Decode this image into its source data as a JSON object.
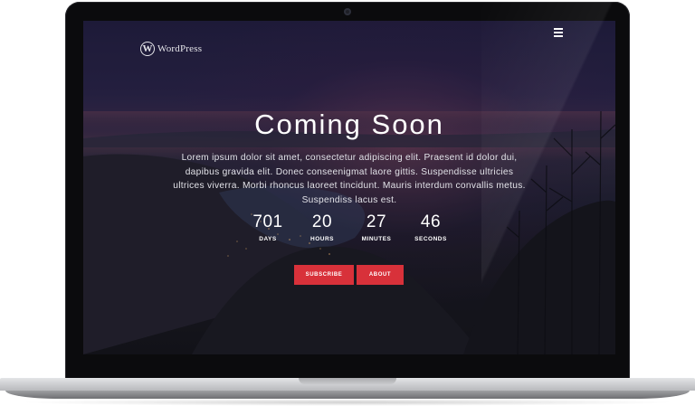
{
  "header": {
    "logo_text": "WordPress",
    "logo_mark": "W",
    "menu_icon": "hamburger-menu-icon"
  },
  "hero": {
    "title": "Coming Soon",
    "description": "Lorem ipsum dolor sit amet, consectetur adipiscing elit. Praesent id dolor dui, dapibus gravida elit. Donec conseenigmat laore gittis. Suspendisse ultricies ultrices viverra. Morbi rhoncus laoreet tincidunt. Mauris interdum convallis metus. Suspendiss lacus est."
  },
  "countdown": [
    {
      "value": "701",
      "label": "DAYS"
    },
    {
      "value": "20",
      "label": "HOURS"
    },
    {
      "value": "27",
      "label": "MINUTES"
    },
    {
      "value": "46",
      "label": "SECONDS"
    }
  ],
  "buttons": {
    "subscribe": "SUBSCRIBE",
    "about": "ABOUT"
  },
  "colors": {
    "accent": "#d8313a",
    "text": "#ffffff"
  }
}
